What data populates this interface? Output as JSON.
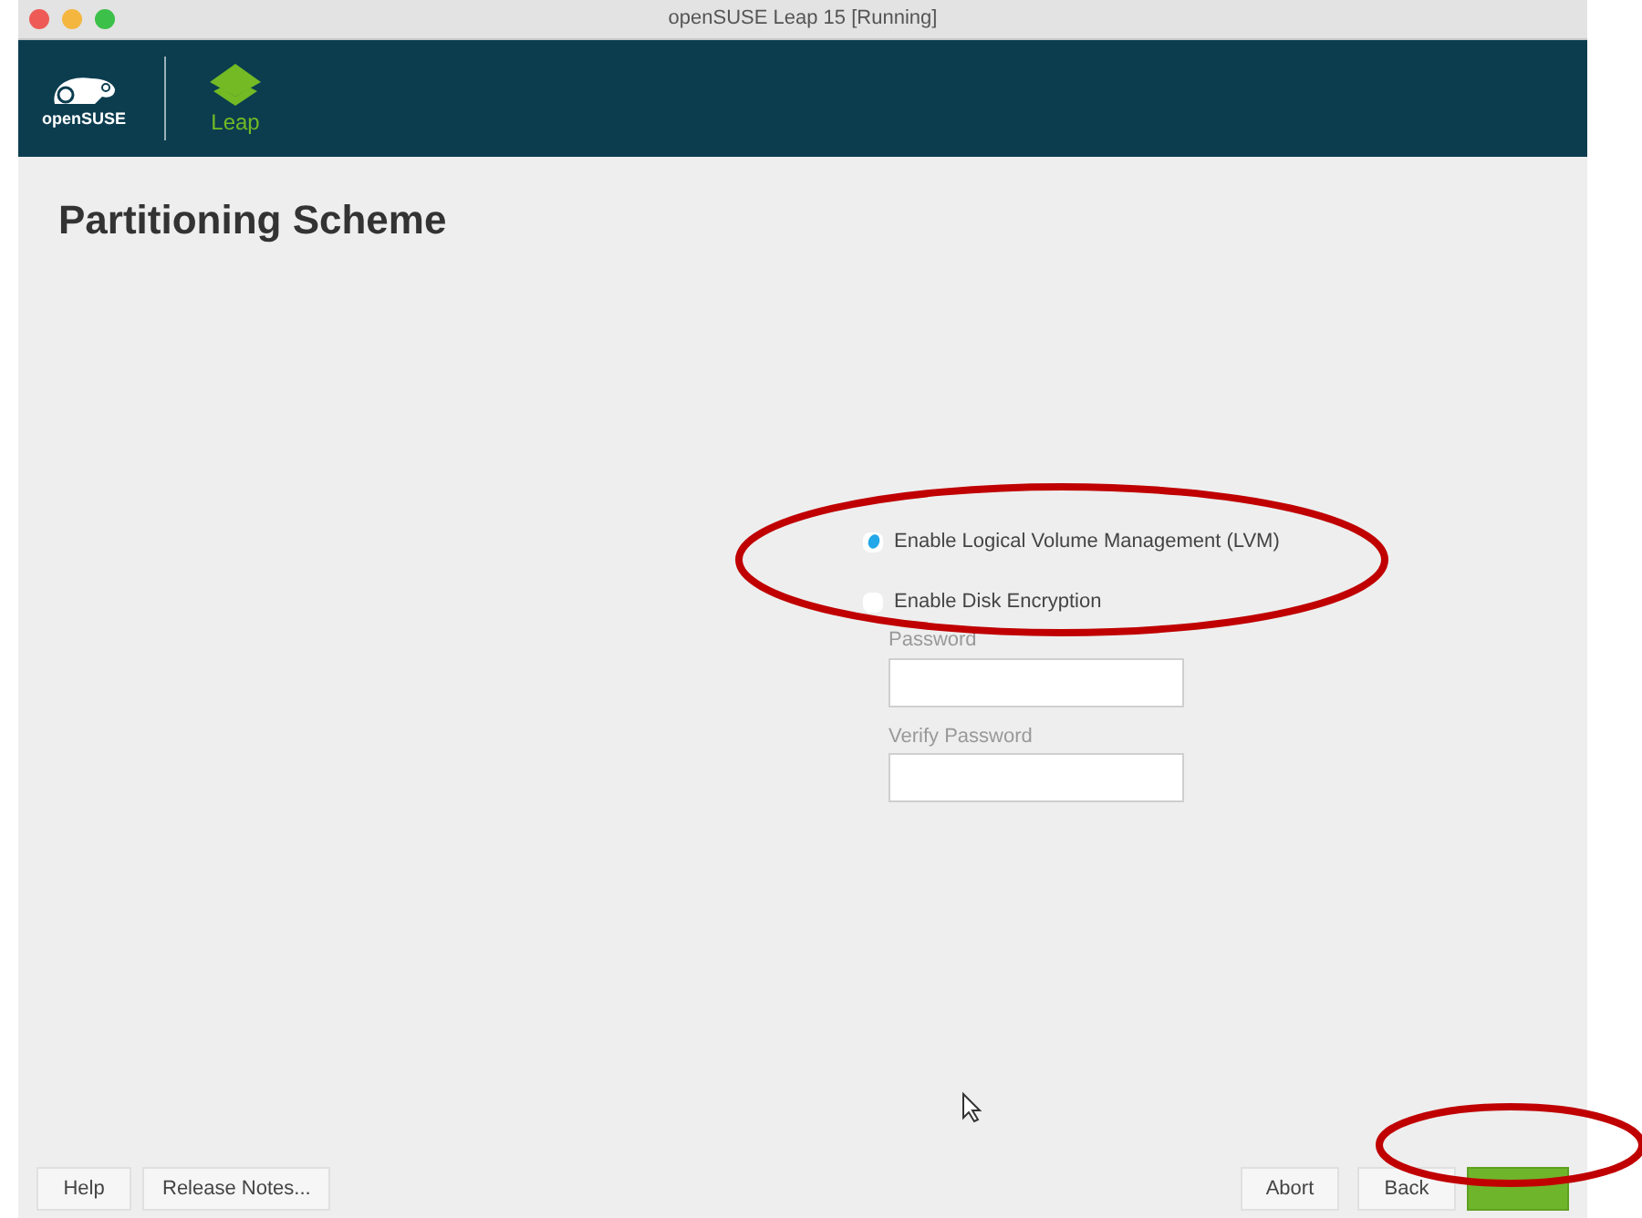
{
  "window": {
    "title": "openSUSE Leap 15 [Running]"
  },
  "header": {
    "logo_text": "openSUSE",
    "product": "Leap"
  },
  "page": {
    "title": "Partitioning Scheme"
  },
  "options": [
    {
      "label": "Enable Logical Volume Management (LVM)",
      "checked": true
    },
    {
      "label": "Enable Disk Encryption",
      "checked": false
    }
  ],
  "fields": [
    {
      "label": "Password",
      "disabled": true
    },
    {
      "label": "Verify Password",
      "disabled": true
    }
  ],
  "buttons_left": [
    "Help",
    "Release Notes..."
  ],
  "buttons_right": [
    {
      "label": "Abort",
      "kind": "plain"
    },
    {
      "label": "Back",
      "kind": "plain"
    },
    {
      "kind": "primary"
    }
  ]
}
